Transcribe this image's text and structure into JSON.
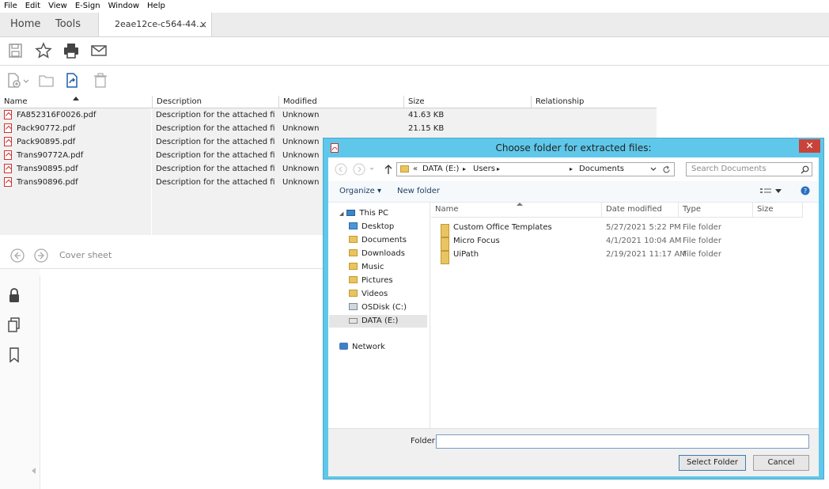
{
  "menu": [
    "File",
    "Edit",
    "View",
    "E-Sign",
    "Window",
    "Help"
  ],
  "tabs": {
    "home": "Home",
    "tools": "Tools",
    "document": "2eae12ce-c564-44...",
    "close_glyph": "×"
  },
  "attachments": {
    "columns": [
      "Name",
      "Description",
      "Modified",
      "Size",
      "Relationship"
    ],
    "rows": [
      {
        "name": "FA852316F0026.pdf",
        "description": "Description for the attached file F...",
        "modified": "Unknown",
        "size": "41.63 KB"
      },
      {
        "name": "Pack90772.pdf",
        "description": "Description for the attached file P...",
        "modified": "Unknown",
        "size": "21.15 KB"
      },
      {
        "name": "Pack90895.pdf",
        "description": "Description for the attached file P...",
        "modified": "Unknown",
        "size": ""
      },
      {
        "name": "Trans90772A.pdf",
        "description": "Description for the attached file T...",
        "modified": "Unknown",
        "size": ""
      },
      {
        "name": "Trans90895.pdf",
        "description": "Description for the attached file T...",
        "modified": "Unknown",
        "size": ""
      },
      {
        "name": "Trans90896.pdf",
        "description": "Description for the attached file T...",
        "modified": "Unknown",
        "size": ""
      }
    ]
  },
  "cover": {
    "label": "Cover sheet"
  },
  "dialog": {
    "title": "Choose folder for extracted files:",
    "close_glyph": "✕",
    "address": {
      "prefix": "«",
      "parts": [
        "DATA (E:)",
        "Users",
        "Documents"
      ]
    },
    "search_placeholder": "Search Documents",
    "organize": "Organize ▾",
    "new_folder": "New folder",
    "nav": {
      "this_pc": "This PC",
      "items": [
        "Desktop",
        "Documents",
        "Downloads",
        "Music",
        "Pictures",
        "Videos",
        "OSDisk (C:)",
        "DATA (E:)"
      ],
      "network": "Network"
    },
    "columns": [
      "Name",
      "Date modified",
      "Type",
      "Size"
    ],
    "files": [
      {
        "name": "Custom Office Templates",
        "date": "5/27/2021 5:22 PM",
        "type": "File folder"
      },
      {
        "name": "Micro Focus",
        "date": "4/1/2021 10:04 AM",
        "type": "File folder"
      },
      {
        "name": "UiPath",
        "date": "2/19/2021 11:17 AM",
        "type": "File folder"
      }
    ],
    "folder_label": "Folder:",
    "folder_value": "",
    "select_button": "Select Folder",
    "cancel_button": "Cancel"
  },
  "colors": {
    "accent": "#5fc8ea",
    "close_red": "#c8443a",
    "pdf_red": "#cc3333",
    "folder_yellow": "#e9c462"
  }
}
